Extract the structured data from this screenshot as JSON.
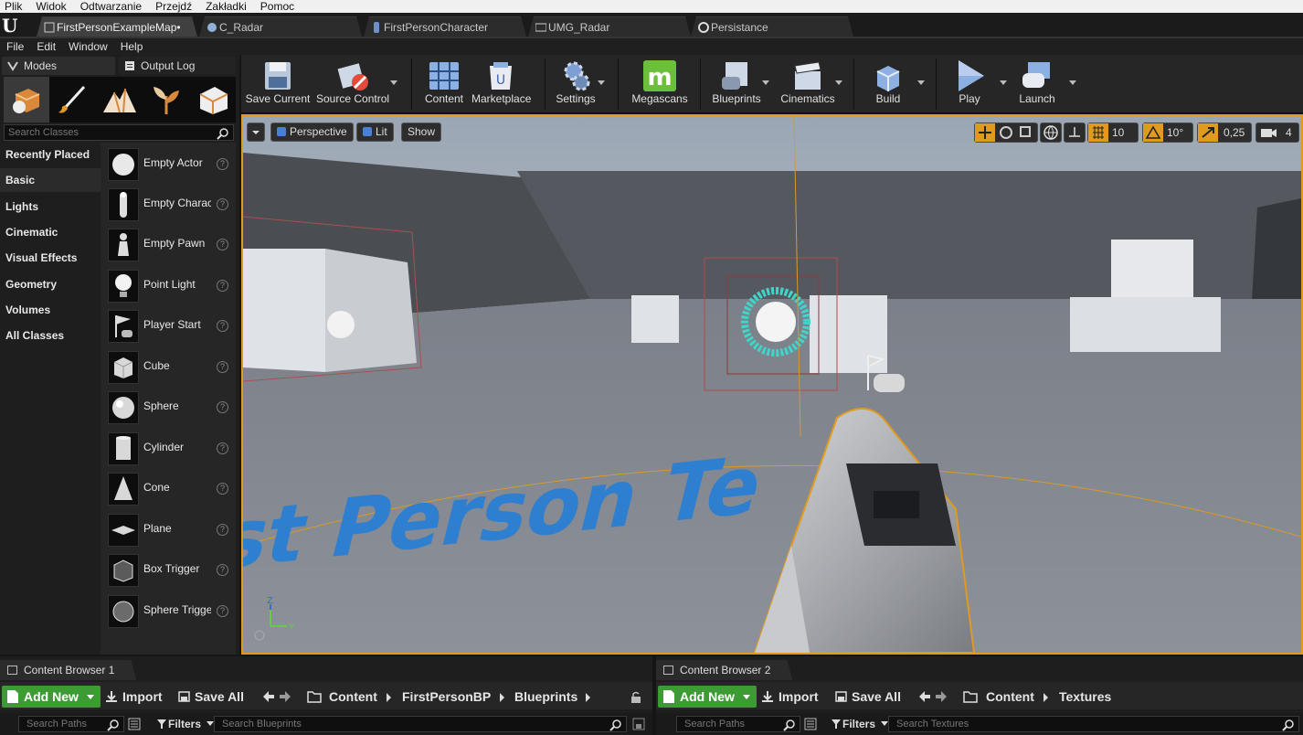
{
  "os_menu": [
    "Plik",
    "Widok",
    "Odtwarzanie",
    "Przejdź",
    "Zakładki",
    "Pomoc"
  ],
  "tabs": [
    {
      "label": "FirstPersonExampleMap•",
      "active": true
    },
    {
      "label": "C_Radar",
      "active": false
    },
    {
      "label": "FirstPersonCharacter",
      "active": false
    },
    {
      "label": "UMG_Radar",
      "active": false
    },
    {
      "label": "Persistance",
      "active": false
    }
  ],
  "main_menu": [
    "File",
    "Edit",
    "Window",
    "Help"
  ],
  "left_panel": {
    "tabs": [
      "Modes",
      "Output Log"
    ],
    "search_placeholder": "Search Classes",
    "categories": [
      "Recently Placed",
      "Basic",
      "Lights",
      "Cinematic",
      "Visual Effects",
      "Geometry",
      "Volumes",
      "All Classes"
    ],
    "selected_category": "Basic",
    "items": [
      "Empty Actor",
      "Empty Charac",
      "Empty Pawn",
      "Point Light",
      "Player Start",
      "Cube",
      "Sphere",
      "Cylinder",
      "Cone",
      "Plane",
      "Box Trigger",
      "Sphere Trigge"
    ],
    "help_glyph": "?"
  },
  "toolbar": {
    "buttons": [
      "Save Current",
      "Source Control",
      "Content",
      "Marketplace",
      "Settings",
      "Megascans",
      "Blueprints",
      "Cinematics",
      "Build",
      "Play",
      "Launch"
    ]
  },
  "viewport": {
    "perspective": "Perspective",
    "lit": "Lit",
    "show": "Show",
    "grid_size": "10",
    "rotation_snap": "10°",
    "scale_snap": "0,25",
    "camera_speed": "4",
    "floor_text": "First Person Te",
    "axis_z": "Z",
    "axis_y": "Y"
  },
  "content_browser_1": {
    "title": "Content Browser 1",
    "add_new": "Add New",
    "import": "Import",
    "save_all": "Save All",
    "path": [
      "Content",
      "FirstPersonBP",
      "Blueprints"
    ],
    "search_paths": "Search Paths",
    "filters": "Filters",
    "search_assets": "Search Blueprints"
  },
  "content_browser_2": {
    "title": "Content Browser 2",
    "add_new": "Add New",
    "import": "Import",
    "save_all": "Save All",
    "path": [
      "Content",
      "Textures"
    ],
    "search_paths": "Search Paths",
    "filters": "Filters",
    "search_assets": "Search Textures"
  },
  "colors": {
    "accent_orange": "#e09b1e",
    "add_new_green": "#3c9c33",
    "megascans_green": "#6cbf3a",
    "floor_text_blue": "#2f7fd0"
  }
}
